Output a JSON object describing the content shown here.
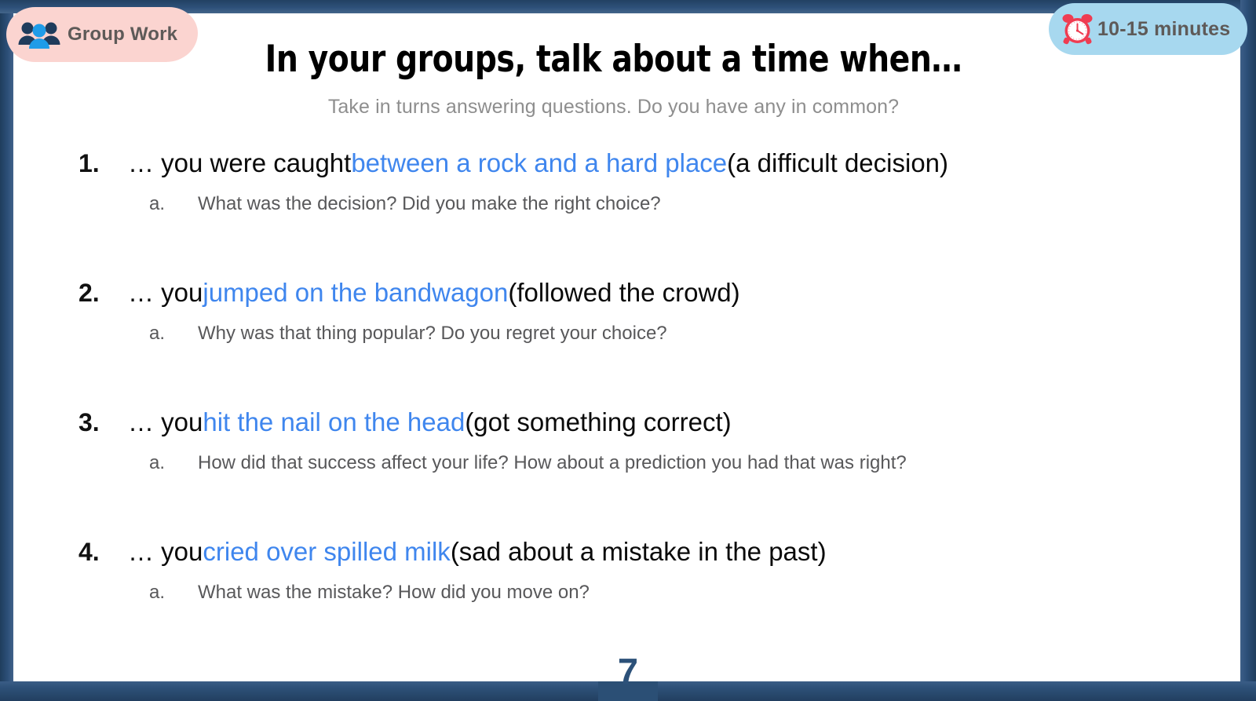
{
  "slide": {
    "title": "In your groups, talk about a time when…",
    "subtitle": "Take in turns answering questions. Do you have any in common?",
    "page_number": "7"
  },
  "badges": {
    "group_work": {
      "label": "Group Work",
      "icon": "people-group-icon",
      "background_color": "#fbd4d0",
      "text_color": "#5e5a58"
    },
    "duration": {
      "label": "10-15 minutes",
      "icon": "alarm-clock-icon",
      "background_color": "#a7d8ef",
      "text_color": "#5e5a58"
    }
  },
  "theme": {
    "frame_color": "#2d5079",
    "idiom_color": "#3f86ee",
    "body_color": "#0a0a0a",
    "sub_text_color": "#58585a",
    "subtitle_color": "#8e8e8e",
    "page_number_color": "#2c5179"
  },
  "items": [
    {
      "number": "1.",
      "prefix": "… you were caught ",
      "idiom": "between a rock and a hard place",
      "suffix": " (a difficult decision)",
      "sub_letter": "a.",
      "sub_text": "What was the decision? Did you make the right choice?"
    },
    {
      "number": "2.",
      "prefix": "… you ",
      "idiom": "jumped on the bandwagon",
      "suffix": " (followed the crowd)",
      "sub_letter": "a.",
      "sub_text": "Why was that thing popular? Do you regret your choice?"
    },
    {
      "number": "3.",
      "prefix": "… you ",
      "idiom": "hit the nail on the head",
      "suffix": " (got something correct)",
      "sub_letter": "a.",
      "sub_text": "How did that success affect your life? How about a prediction you had that was right?"
    },
    {
      "number": "4.",
      "prefix": "… you ",
      "idiom": "cried over spilled milk",
      "suffix": " (sad about a mistake in the past)",
      "sub_letter": "a.",
      "sub_text": "What was the mistake? How did you move on?"
    }
  ]
}
